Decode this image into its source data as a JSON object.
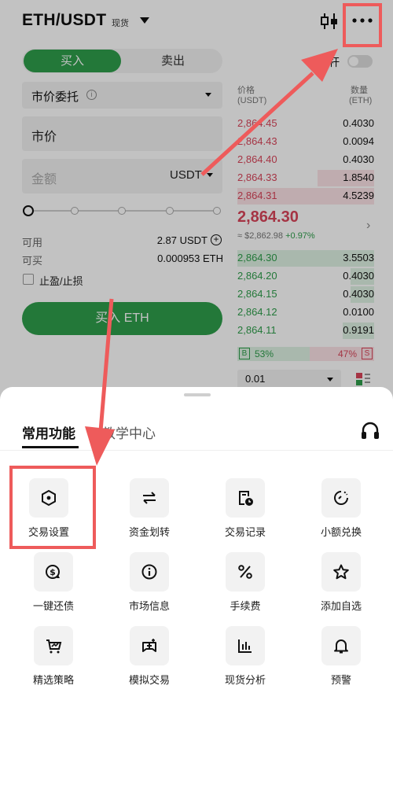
{
  "header": {
    "pair": "ETH/USDT",
    "market_tag": "现货",
    "icons": [
      "candle-chart-icon",
      "more-icon"
    ]
  },
  "trade": {
    "tab_buy": "买入",
    "tab_sell": "卖出",
    "order_type": "市价委托",
    "price_field": "市价",
    "amount_placeholder": "金额",
    "amount_unit": "USDT",
    "available_label": "可用",
    "available_value": "2.87 USDT",
    "can_buy_label": "可买",
    "can_buy_value": "0.000953 ETH",
    "tpsl_label": "止盈/止损",
    "buy_button": "买入 ETH",
    "leverage_label": "杆"
  },
  "orderbook": {
    "price_header": "价格",
    "price_unit": "(USDT)",
    "qty_header": "数量",
    "qty_unit": "(ETH)",
    "asks": [
      {
        "price": "2,864.45",
        "qty": "0.4030"
      },
      {
        "price": "2,864.43",
        "qty": "0.0094"
      },
      {
        "price": "2,864.40",
        "qty": "0.4030"
      },
      {
        "price": "2,864.33",
        "qty": "1.8540"
      },
      {
        "price": "2,864.31",
        "qty": "4.5239"
      }
    ],
    "last_price": "2,864.30",
    "last_fiat": "≈ $2,862.98",
    "last_change": "+0.97%",
    "bids": [
      {
        "price": "2,864.30",
        "qty": "3.5503"
      },
      {
        "price": "2,864.20",
        "qty": "0.4030"
      },
      {
        "price": "2,864.15",
        "qty": "0.4030"
      },
      {
        "price": "2,864.12",
        "qty": "0.0100"
      },
      {
        "price": "2,864.11",
        "qty": "0.9191"
      }
    ],
    "buy_badge": "B",
    "buy_ratio": "53%",
    "sell_ratio": "47%",
    "sell_badge": "S",
    "depth_value": "0.01",
    "colors": {
      "ask": "#d9455a",
      "bid": "#2e9e4b"
    }
  },
  "sheet": {
    "tab_common": "常用功能",
    "tab_learn": "教学中心",
    "items": [
      {
        "label": "交易设置",
        "icon": "hexagon-settings-icon"
      },
      {
        "label": "资金划转",
        "icon": "transfer-icon"
      },
      {
        "label": "交易记录",
        "icon": "record-clock-icon"
      },
      {
        "label": "小额兑换",
        "icon": "small-exchange-icon"
      },
      {
        "label": "一键还债",
        "icon": "repay-dollar-icon"
      },
      {
        "label": "市场信息",
        "icon": "info-icon"
      },
      {
        "label": "手续费",
        "icon": "percent-icon"
      },
      {
        "label": "添加自选",
        "icon": "star-icon"
      },
      {
        "label": "精选策略",
        "icon": "strategy-cart-icon"
      },
      {
        "label": "模拟交易",
        "icon": "simulated-trade-icon"
      },
      {
        "label": "现货分析",
        "icon": "bar-analysis-icon"
      },
      {
        "label": "预警",
        "icon": "bell-icon"
      }
    ]
  },
  "annotation_color": "#ee5b5b"
}
